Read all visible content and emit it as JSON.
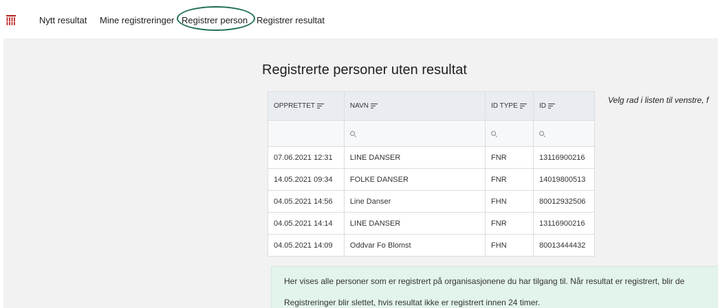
{
  "nav": {
    "items": [
      {
        "label": "Nytt resultat"
      },
      {
        "label": "Mine registreringer"
      },
      {
        "label": "Registrer person"
      },
      {
        "label": "Registrer resultat"
      }
    ],
    "highlighted_color": "#1e6e4e",
    "logo_icon": "test-tubes-icon"
  },
  "page": {
    "title": "Registrerte personer uten resultat",
    "side_text": "Velg rad i listen til venstre, f"
  },
  "table": {
    "columns": [
      {
        "label": "OPPRETTET"
      },
      {
        "label": "NAVN"
      },
      {
        "label": "ID TYPE"
      },
      {
        "label": "ID"
      }
    ],
    "rows": [
      {
        "created": "07.06.2021 12:31",
        "name": "LINE DANSER",
        "id_type": "FNR",
        "id": "13116900216"
      },
      {
        "created": "14.05.2021 09:34",
        "name": "FOLKE DANSER",
        "id_type": "FNR",
        "id": "14019800513"
      },
      {
        "created": "04.05.2021 14:56",
        "name": "Line Danser",
        "id_type": "FHN",
        "id": "80012932506"
      },
      {
        "created": "04.05.2021 14:14",
        "name": "LINE DANSER",
        "id_type": "FNR",
        "id": "13116900216"
      },
      {
        "created": "04.05.2021 14:09",
        "name": "Oddvar Fo Blomst",
        "id_type": "FHN",
        "id": "80013444432"
      }
    ]
  },
  "info": {
    "line1": "Her vises alle personer som er registrert på organisasjonene du har tilgang til. Når resultat er registrert, blir de",
    "line2": "Registreringer blir slettet, hvis resultat ikke er registrert innen 24 timer."
  }
}
